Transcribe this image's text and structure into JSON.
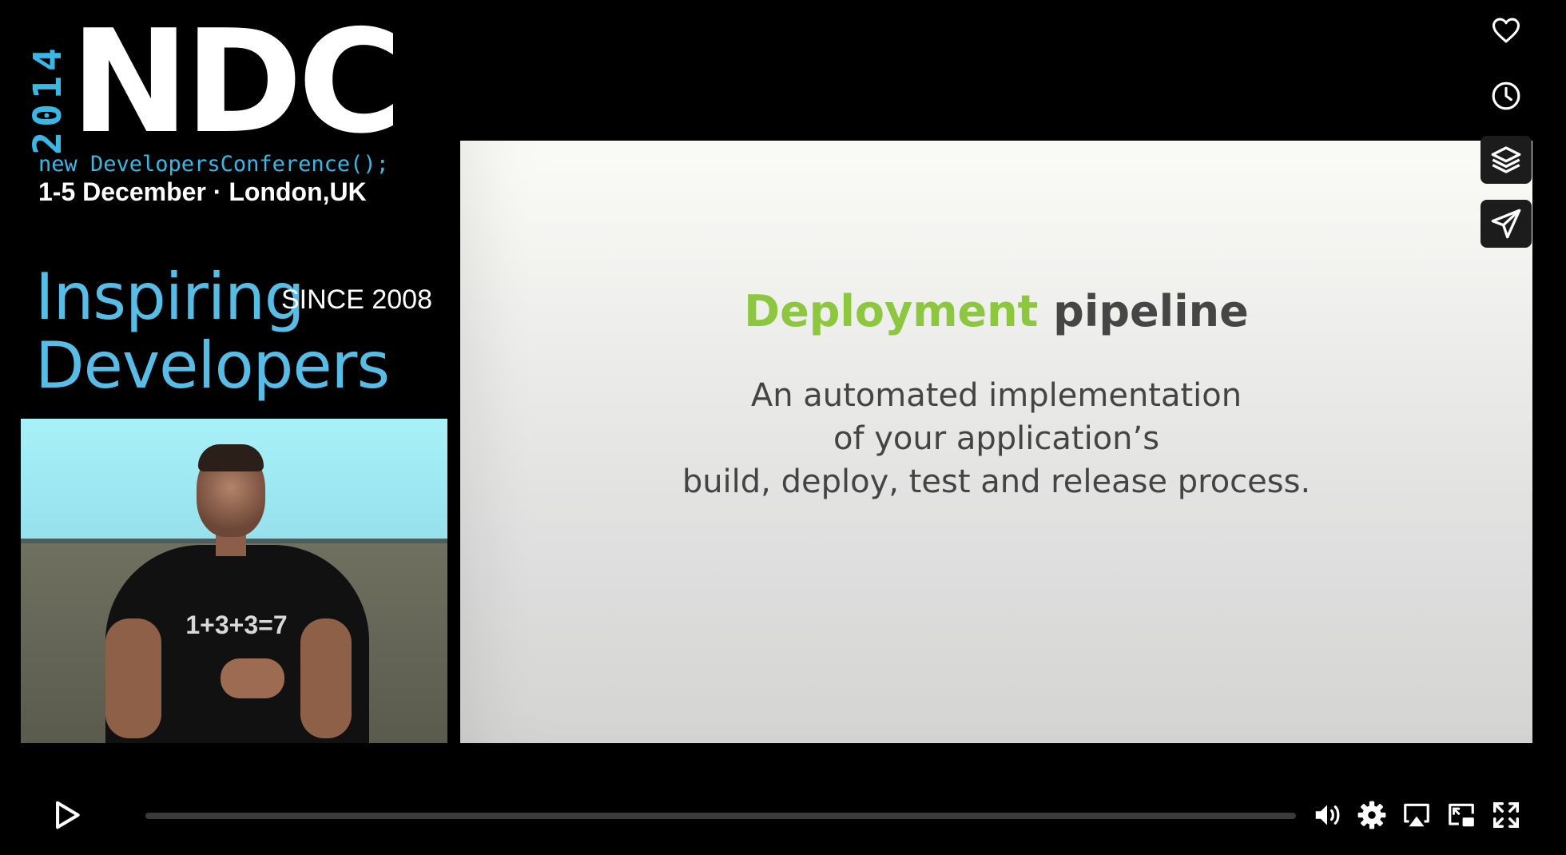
{
  "branding": {
    "year": "2014",
    "logo": "NDC",
    "code_tagline": "new DevelopersConference();",
    "dates": "1-5 December · London,UK",
    "slogan_line1": "Inspiring",
    "slogan_since": "SINCE 2008",
    "slogan_line2": "Developers"
  },
  "camera": {
    "shirt_text": "1+3+3=7"
  },
  "slide": {
    "title_accent": "Deployment",
    "title_rest": "pipeline",
    "lines": [
      "An automated implementation",
      "of your application’s",
      "build, deploy, test and release process."
    ]
  },
  "side_actions": [
    "heart-icon",
    "clock-icon",
    "layers-icon",
    "send-icon"
  ],
  "player": {
    "progress": 0.0,
    "controls": [
      "play-icon",
      "volume-icon",
      "gear-icon",
      "airplay-icon",
      "pip-icon",
      "fullscreen-icon"
    ]
  },
  "colors": {
    "accent_green": "#8dc63f",
    "brand_blue": "#39b8e6"
  }
}
